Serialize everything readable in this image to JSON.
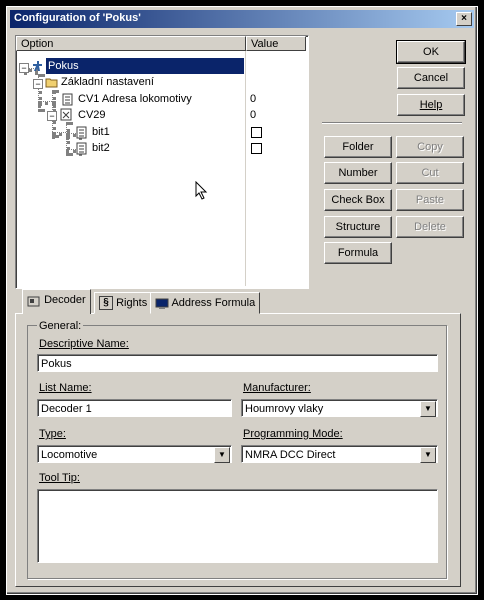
{
  "window": {
    "title": "Configuration of 'Pokus'",
    "close_label": "×"
  },
  "tree": {
    "columns": {
      "option": "Option",
      "value": "Value"
    },
    "rows": [
      {
        "label": "Pokus",
        "value": ""
      },
      {
        "label": "Základní nastavení",
        "value": ""
      },
      {
        "label": "CV1 Adresa lokomotivy",
        "value": "0"
      },
      {
        "label": "CV29",
        "value": "0"
      },
      {
        "label": "bit1",
        "value": ""
      },
      {
        "label": "bit2",
        "value": ""
      }
    ]
  },
  "buttons": {
    "ok": "OK",
    "cancel": "Cancel",
    "help": "Help",
    "folder": "Folder",
    "copy": "Copy",
    "number": "Number",
    "cut": "Cut",
    "checkbox": "Check Box",
    "paste": "Paste",
    "structure": "Structure",
    "delete": "Delete",
    "formula": "Formula"
  },
  "tabs": {
    "decoder": "Decoder",
    "rights": "Rights",
    "address_formula": "Address Formula"
  },
  "form": {
    "group_label": "General:",
    "descriptive_name_label": "Descriptive Name:",
    "descriptive_name_value": "Pokus",
    "list_name_label": "List Name:",
    "list_name_value": "Decoder 1",
    "manufacturer_label": "Manufacturer:",
    "manufacturer_value": "Houmrovy vlaky",
    "type_label": "Type:",
    "type_value": "Locomotive",
    "programming_mode_label": "Programming Mode:",
    "programming_mode_value": "NMRA DCC Direct",
    "tooltip_label": "Tool Tip:",
    "tooltip_value": ""
  }
}
